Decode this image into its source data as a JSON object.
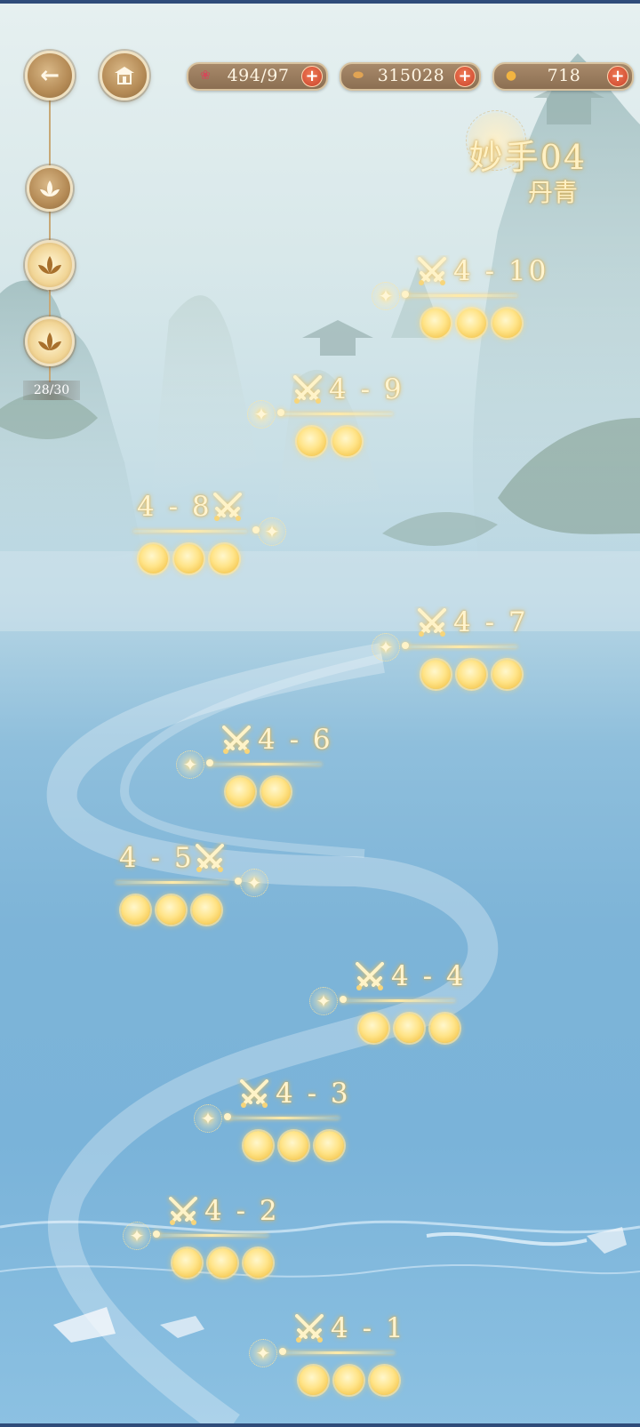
{
  "resources": [
    {
      "icon": "peach-icon",
      "value": "494/97",
      "color": "#d24a5a"
    },
    {
      "icon": "coin-icon",
      "value": "315028",
      "color": "#c9822e"
    },
    {
      "icon": "gold-icon",
      "value": "718",
      "color": "#e7a93a"
    }
  ],
  "nav": {
    "back_label": "←",
    "progress": "28/30"
  },
  "chapter": {
    "name": "妙手04",
    "subtitle": "丹青"
  },
  "stages": [
    {
      "label": "4-10",
      "stars": 3
    },
    {
      "label": "4-9",
      "stars": 2
    },
    {
      "label": "4-8",
      "stars": 3
    },
    {
      "label": "4-7",
      "stars": 3
    },
    {
      "label": "4-6",
      "stars": 2
    },
    {
      "label": "4-5",
      "stars": 3
    },
    {
      "label": "4-4",
      "stars": 3
    },
    {
      "label": "4-3",
      "stars": 3
    },
    {
      "label": "4-2",
      "stars": 3
    },
    {
      "label": "4-1",
      "stars": 3
    }
  ],
  "colors": {
    "accent_gold": "#fff4cf",
    "plus_red": "#c9432b",
    "frame_brown": "#8c6f52"
  }
}
